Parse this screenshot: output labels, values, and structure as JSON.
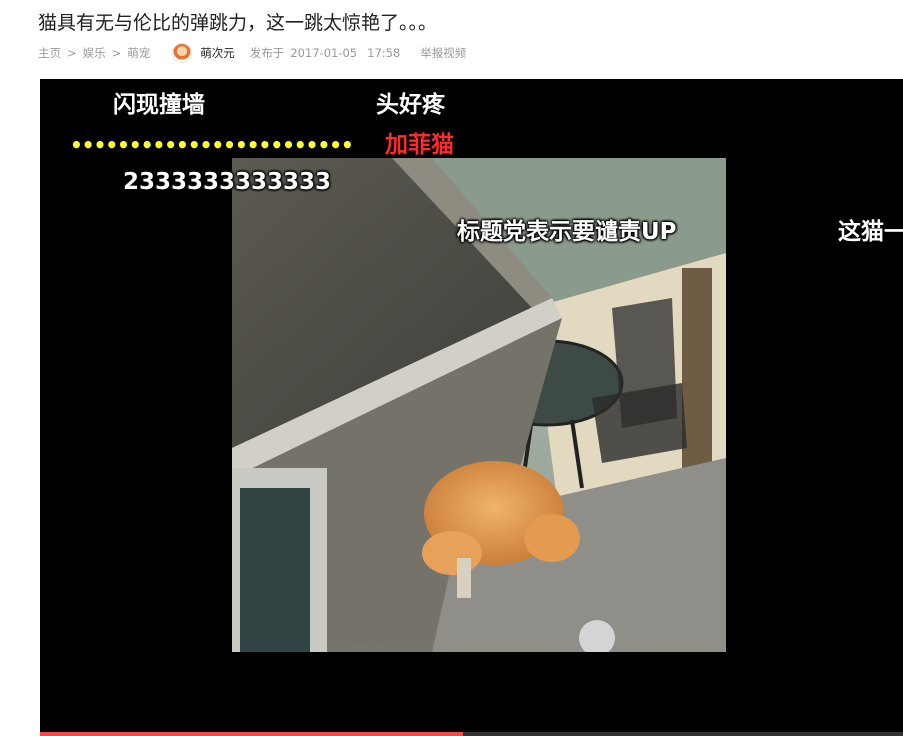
{
  "title": "猫具有无与伦比的弹跳力，这一跳太惊艳了。。。",
  "breadcrumb": [
    "主页",
    "娱乐",
    "萌宠"
  ],
  "breadcrumb_sep": ">",
  "uploader": "萌次元",
  "published_label": "发布于",
  "date": "2017-01-05",
  "time": "17:58",
  "report_label": "举报视频",
  "player": {
    "progress_fraction": 0.49,
    "progress_color": "#f04b4b",
    "danmaku": [
      "闪现撞墙",
      "头好疼",
      "加菲猫",
      "••••••••••••••••••••••••",
      "2333333333333",
      "标题党表示要谴责UP",
      "这猫一"
    ]
  }
}
